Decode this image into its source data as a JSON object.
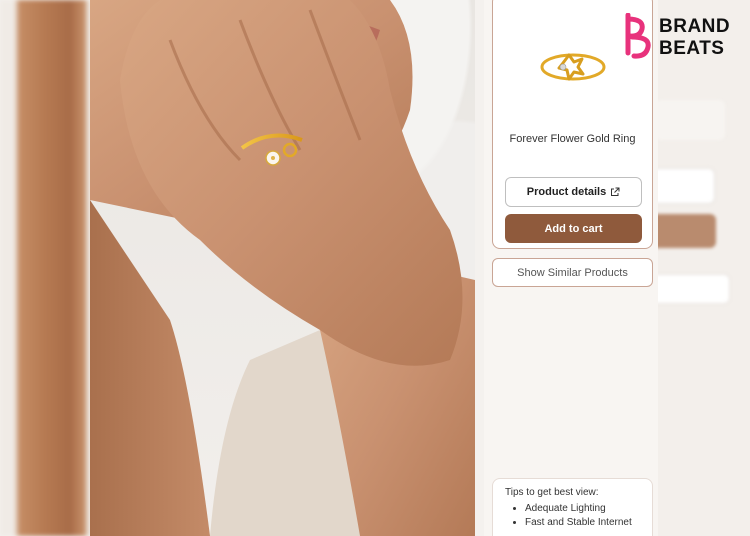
{
  "brand": {
    "line1": "BRAND",
    "line2": "BEATS",
    "accent_color": "#e8327c"
  },
  "product": {
    "name": "Forever Flower Gold Ring",
    "details_label": "Product details",
    "details_icon": "external-link-icon",
    "cart_label": "Add to cart",
    "cart_color": "#8f5a3c"
  },
  "similar_label": "Show Similar Products",
  "tips": {
    "title": "Tips to get best view:",
    "items": [
      "Adequate Lighting",
      "Fast and Stable Internet"
    ]
  }
}
